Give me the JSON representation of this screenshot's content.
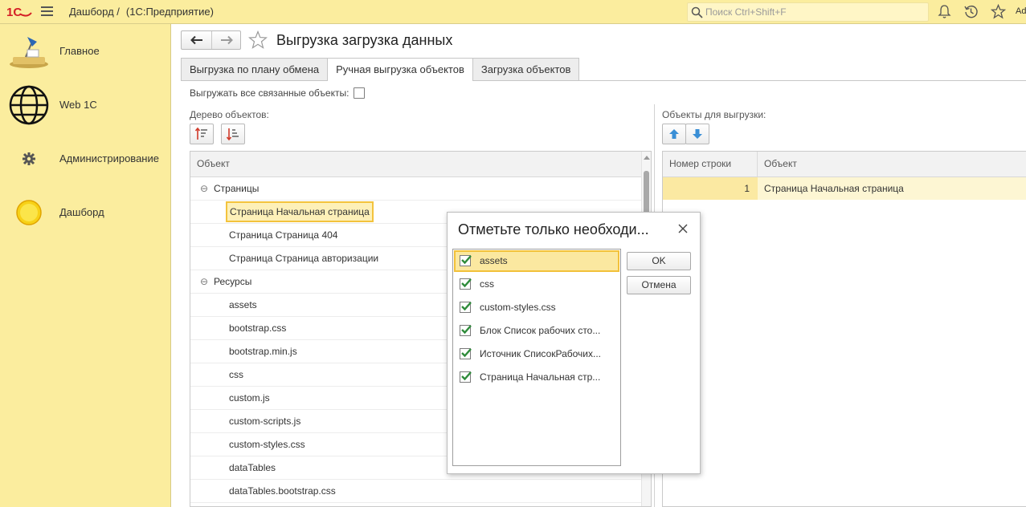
{
  "topbar": {
    "breadcrumb": "Дашборд /",
    "app_name": "(1С:Предприятие)",
    "search_placeholder": "Поиск Ctrl+Shift+F",
    "user_initials": "Ad"
  },
  "sidebar": {
    "items": [
      {
        "label": "Главное",
        "icon": "desk-lamp-icon"
      },
      {
        "label": "Web 1C",
        "icon": "globe-icon"
      },
      {
        "label": "Администрирование",
        "icon": "gear-icon"
      },
      {
        "label": "Дашборд",
        "icon": "sun-icon"
      }
    ]
  },
  "page": {
    "title": "Выгрузка загрузка данных",
    "tabs": [
      {
        "label": "Выгрузка по плану обмена",
        "active": false
      },
      {
        "label": "Ручная выгрузка объектов",
        "active": true
      },
      {
        "label": "Загрузка объектов",
        "active": false
      }
    ],
    "export_related_label": "Выгружать все связанные объекты:",
    "export_related_checked": false,
    "tree_label": "Дерево объектов:",
    "export_objects_label": "Объекты для выгрузки:"
  },
  "tree": {
    "column_header": "Объект",
    "rows": [
      {
        "type": "group",
        "toggle": "⊖",
        "label": "Страницы"
      },
      {
        "type": "leaf",
        "label": "Страница Начальная страница",
        "selected": true
      },
      {
        "type": "leaf",
        "label": "Страница Страница 404"
      },
      {
        "type": "leaf",
        "label": "Страница Страница авторизации"
      },
      {
        "type": "group",
        "toggle": "⊖",
        "label": "Ресурсы"
      },
      {
        "type": "leaf",
        "label": "assets"
      },
      {
        "type": "leaf",
        "label": "bootstrap.css"
      },
      {
        "type": "leaf",
        "label": "bootstrap.min.js"
      },
      {
        "type": "leaf",
        "label": "css"
      },
      {
        "type": "leaf",
        "label": "custom.js"
      },
      {
        "type": "leaf",
        "label": "custom-scripts.js"
      },
      {
        "type": "leaf",
        "label": "custom-styles.css"
      },
      {
        "type": "leaf",
        "label": "dataTables"
      },
      {
        "type": "leaf",
        "label": "dataTables.bootstrap.css"
      }
    ]
  },
  "export_table": {
    "columns": [
      "Номер строки",
      "Объект"
    ],
    "rows": [
      {
        "num": "1",
        "object": "Страница Начальная страница"
      }
    ]
  },
  "dialog": {
    "title": "Отметьте только необходи...",
    "items": [
      {
        "label": "assets",
        "checked": true,
        "selected": true
      },
      {
        "label": "css",
        "checked": true
      },
      {
        "label": "custom-styles.css",
        "checked": true
      },
      {
        "label": "Блок Список рабочих сто...",
        "checked": true
      },
      {
        "label": "Источник СписокРабочих...",
        "checked": true
      },
      {
        "label": "Страница Начальная стр...",
        "checked": true
      }
    ],
    "ok_label": "OK",
    "cancel_label": "Отмена"
  },
  "colors": {
    "accent_yellow": "#fbed9e",
    "selection_border": "#f2c13a",
    "check_green": "#2e8b3a",
    "arrow_blue": "#3a8fd6"
  }
}
